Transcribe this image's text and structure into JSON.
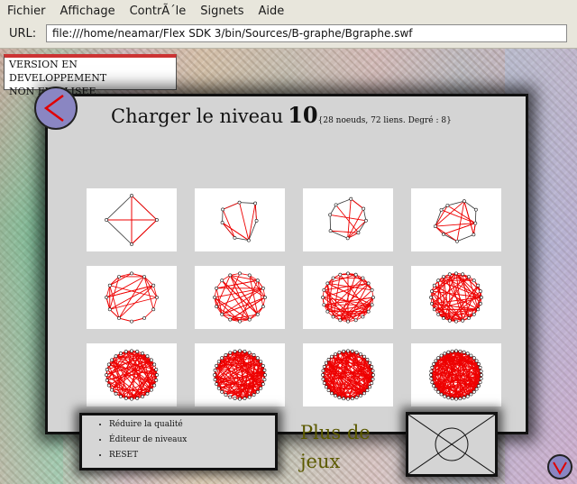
{
  "menubar": {
    "items": [
      "Fichier",
      "Affichage",
      "ContrÃ´le",
      "Signets",
      "Aide"
    ]
  },
  "urlbar": {
    "label": "URL:",
    "value": "file:///home/neamar/Flex SDK 3/bin/Sources/B-graphe/Bgraphe.swf"
  },
  "version_badge": {
    "line1": "VERSION EN DEVELOPPEMENT",
    "line2": "NON FINALISEE"
  },
  "level_panel": {
    "title_prefix": "Charger le niveau",
    "level_number": "10",
    "level_info": "{28 noeuds, 72 liens. Degré : 8}",
    "thumbnail_count": 12,
    "edge_color": "#ee0000"
  },
  "options_menu": {
    "items": [
      "Réduire la qualité",
      "Éditeur de niveaux",
      "RESET"
    ]
  },
  "more_games": {
    "line1": "Plus de",
    "line2": "jeux"
  },
  "colors": {
    "panel_bg": "#d4d4d4",
    "nav_button": "#8a86c2",
    "version_border": "#cc3333",
    "more_games_text": "#5c5a00"
  },
  "icons": {
    "back": "chevron-left-icon",
    "down": "chevron-down-icon",
    "mail": "envelope-icon"
  }
}
